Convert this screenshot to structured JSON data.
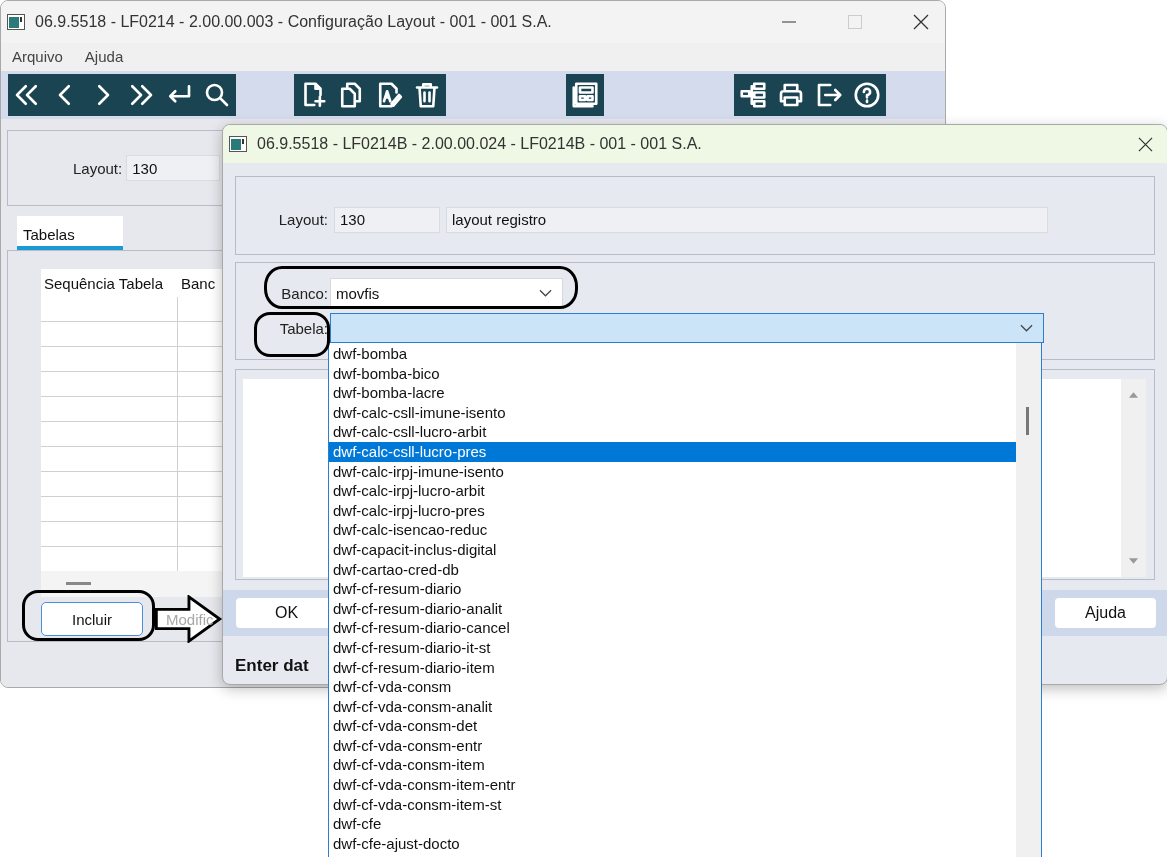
{
  "main_window": {
    "title": "06.9.5518 - LF0214 - 2.00.00.003 - Configuração Layout - 001 - 001 S.A.",
    "menu": [
      "Arquivo",
      "Ajuda"
    ],
    "layout_label": "Layout:",
    "layout_value": "130",
    "tabs": [
      {
        "label": "Tabelas",
        "selected": true
      }
    ],
    "table": {
      "columns": [
        "Sequência Tabela",
        "Banc"
      ]
    },
    "buttons": [
      {
        "label": "Incluir",
        "disabled": false
      },
      {
        "label": "Modific",
        "disabled": true
      }
    ]
  },
  "dialog": {
    "title": "06.9.5518 - LF0214B - 2.00.00.024 - LF0214B - 001 - 001 S.A.",
    "layout_label": "Layout:",
    "layout_code": "130",
    "layout_name": "layout registro",
    "banco": {
      "label": "Banco:",
      "value": "movfis"
    },
    "tabela": {
      "label": "Tabela:"
    },
    "buttons": [
      "OK",
      "Ajuda"
    ],
    "status": "Enter dat",
    "dropdown": {
      "items": [
        {
          "label": "dwf-bomba",
          "selected": false
        },
        {
          "label": "dwf-bomba-bico",
          "selected": false
        },
        {
          "label": "dwf-bomba-lacre",
          "selected": false
        },
        {
          "label": "dwf-calc-csll-imune-isento",
          "selected": false
        },
        {
          "label": "dwf-calc-csll-lucro-arbit",
          "selected": false
        },
        {
          "label": "dwf-calc-csll-lucro-pres",
          "selected": true
        },
        {
          "label": "dwf-calc-irpj-imune-isento",
          "selected": false
        },
        {
          "label": "dwf-calc-irpj-lucro-arbit",
          "selected": false
        },
        {
          "label": "dwf-calc-irpj-lucro-pres",
          "selected": false
        },
        {
          "label": "dwf-calc-isencao-reduc",
          "selected": false
        },
        {
          "label": "dwf-capacit-inclus-digital",
          "selected": false
        },
        {
          "label": "dwf-cartao-cred-db",
          "selected": false
        },
        {
          "label": "dwf-cf-resum-diario",
          "selected": false
        },
        {
          "label": "dwf-cf-resum-diario-analit",
          "selected": false
        },
        {
          "label": "dwf-cf-resum-diario-cancel",
          "selected": false
        },
        {
          "label": "dwf-cf-resum-diario-it-st",
          "selected": false
        },
        {
          "label": "dwf-cf-resum-diario-item",
          "selected": false
        },
        {
          "label": "dwf-cf-vda-consm",
          "selected": false
        },
        {
          "label": "dwf-cf-vda-consm-analit",
          "selected": false
        },
        {
          "label": "dwf-cf-vda-consm-det",
          "selected": false
        },
        {
          "label": "dwf-cf-vda-consm-entr",
          "selected": false
        },
        {
          "label": "dwf-cf-vda-consm-item",
          "selected": false
        },
        {
          "label": "dwf-cf-vda-consm-item-entr",
          "selected": false
        },
        {
          "label": "dwf-cf-vda-consm-item-st",
          "selected": false
        },
        {
          "label": "dwf-cfe",
          "selected": false
        },
        {
          "label": "dwf-cfe-ajust-docto",
          "selected": false
        }
      ]
    }
  }
}
